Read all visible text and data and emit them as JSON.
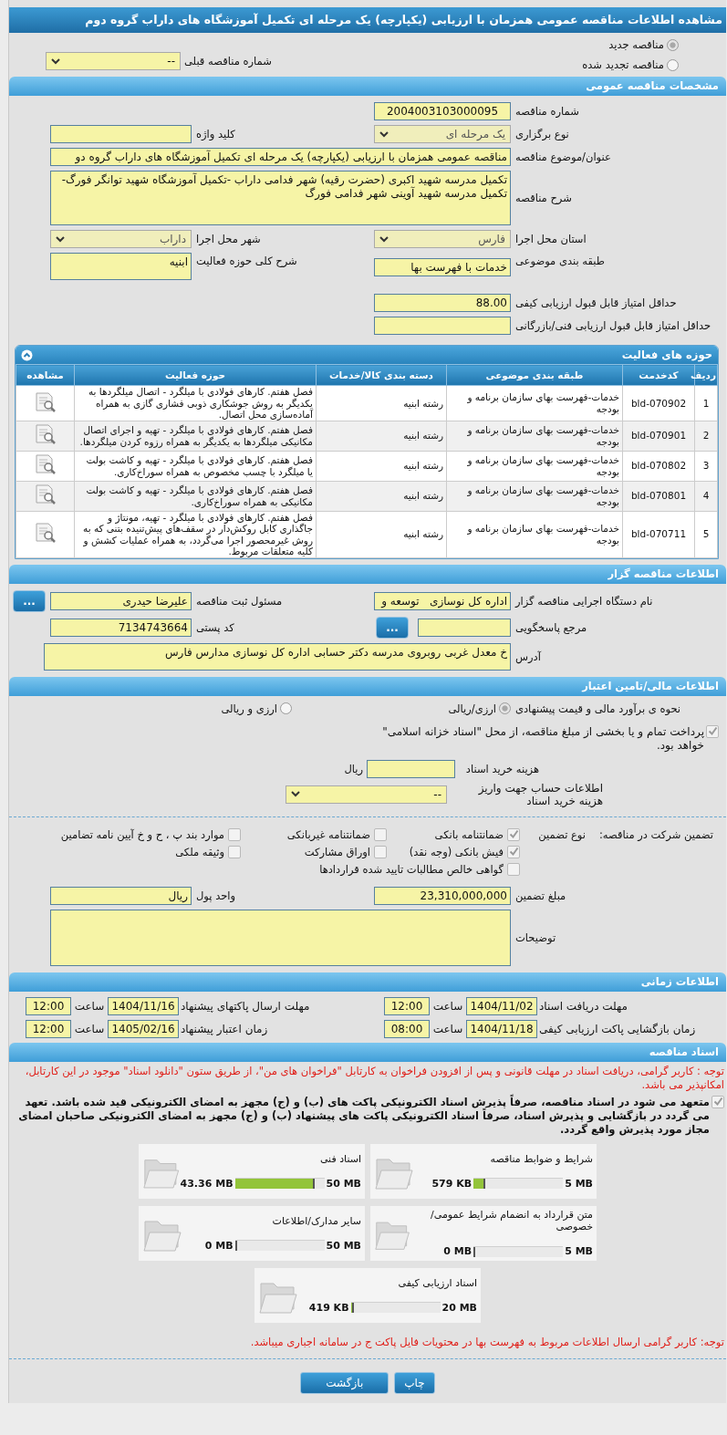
{
  "window": {
    "title": "مشاهده اطلاعات مناقصه عمومی همزمان با ارزیابی (یکپارچه) یک مرحله ای تکمیل آموزشگاه های داراب گروه دوم"
  },
  "tender_type": {
    "options": [
      {
        "label": "مناقصه جدید",
        "selected": true
      },
      {
        "label": "مناقصه تجدید شده",
        "selected": false
      }
    ],
    "previous": {
      "label": "شماره مناقصه قبلی",
      "value": "--",
      "disabled": false
    }
  },
  "general": {
    "heading": "مشخصات مناقصه عمومی",
    "number": {
      "label": "شماره مناقصه",
      "value": "2004003103000095"
    },
    "holding_type": {
      "label": "نوع برگزاری",
      "value": "یک مرحله ای",
      "disabled": true
    },
    "keyword": {
      "label": "کلید واژه"
    },
    "subject": {
      "label": "عنوان/موضوع مناقصه",
      "value": "مناقصه عمومی همزمان با ارزیابی (یکپارچه) یک مرحله ای تکمیل آموزشگاه های داراب گروه دو"
    },
    "description": {
      "label": "شرح مناقصه",
      "value": "تکمیل مدرسه شهید اکبری (حضرت رقیه) شهر فدامی داراب -تکمیل آموزشگاه شهید توانگر فورگ-تکمیل مدرسه شهید آوینی شهر فدامی فورگ"
    },
    "province": {
      "label": "استان محل اجرا",
      "value": "فارس",
      "disabled": true
    },
    "city": {
      "label": "شهر محل اجرا",
      "value": "داراب",
      "disabled": true
    },
    "category": {
      "label": "طبقه بندی موضوعی",
      "value": "خدمات با فهرست بها"
    },
    "activity_scope": {
      "label": "شرح کلی حوزه فعالیت",
      "value": "ابنیه"
    },
    "min_quality_score": {
      "label": "حداقل امتیاز قابل قبول ارزیابی کیفی",
      "value": "88.00"
    },
    "min_technical_score": {
      "label": "حداقل امتیاز قابل قبول ارزیابی فنی/بازرگانی"
    }
  },
  "activities": {
    "heading": "حوزه های فعالیت",
    "expanded": true,
    "columns": [
      "ردیف",
      "کدخدمت",
      "طبقه بندی موضوعی",
      "دسته بندی کالا/خدمات",
      "حوزه فعالیت",
      "مشاهده"
    ],
    "rows": [
      {
        "index": "1",
        "code": "bld-070902",
        "category": "خدمات-فهرست بهای سازمان برنامه و بودجه",
        "group": "رشته ابنیه",
        "scope": "فصل هفتم. کارهای فولادی با میلگرد - اتصال میلگردها به یکدیگر به روش جوشکاری ذوبی فشاری گازی به همراه آماده‌سازی محل اتصال."
      },
      {
        "index": "2",
        "code": "bld-070901",
        "category": "خدمات-فهرست بهای سازمان برنامه و بودجه",
        "group": "رشته ابنیه",
        "scope": "فصل هفتم. کارهای فولادی با میلگرد - تهیه و اجرای اتصال مکانیکی میلگردها به یکدیگر به همراه رزوه کردن میلگردها."
      },
      {
        "index": "3",
        "code": "bld-070802",
        "category": "خدمات-فهرست بهای سازمان برنامه و بودجه",
        "group": "رشته ابنیه",
        "scope": "فصل هفتم. کارهای فولادی با میلگرد - تهیه و کاشت بولت یا میلگرد با چسب مخصوص به همراه سوراخ‌کاری."
      },
      {
        "index": "4",
        "code": "bld-070801",
        "category": "خدمات-فهرست بهای سازمان برنامه و بودجه",
        "group": "رشته ابنیه",
        "scope": "فصل هفتم. کارهای فولادی با میلگرد - تهیه و کاشت بولت مکانیکی به همراه سوراخ‌کاری."
      },
      {
        "index": "5",
        "code": "bld-070711",
        "category": "خدمات-فهرست بهای سازمان برنامه و بودجه",
        "group": "رشته ابنیه",
        "scope": "فصل هفتم. کارهای فولادی با میلگرد - تهیه، مونتاژ و جاگذاری کابل روکش‌دار در سقف‌های پیش‌تنیده بتنی که به روش غیرمحصور اجرا می‌گردد، به همراه عملیات کشش و کلیه متعلقات مربوط."
      }
    ]
  },
  "issuer": {
    "heading": "اطلاعات مناقصه گزار",
    "agency": {
      "label": "نام دستگاه اجرایی مناقصه گزار",
      "value": "اداره کل نوسازی   توسعه و"
    },
    "registrar": {
      "label": "مسئول ثبت مناقصه",
      "value": "علیرضا حیدری",
      "button": "..."
    },
    "contact": {
      "label": "مرجع پاسخگویی",
      "button": "..."
    },
    "postal_code": {
      "label": "کد پستی",
      "value": "7134743664"
    },
    "address": {
      "label": "آدرس",
      "value": "خ معدل غربی روبروی مدرسه دکتر حسابی اداره کل نوسازی مدارس فارس"
    }
  },
  "finance": {
    "heading": "اطلاعات مالی/تامین اعتبار",
    "estimate_label": "نحوه ی برآورد مالی و قیمت پیشنهادی",
    "estimate_options": [
      {
        "label": "ارزی/ریالی",
        "selected": true
      },
      {
        "label": "ارزی و ریالی",
        "selected": false
      }
    ],
    "treasury": {
      "checked": true,
      "text": "پرداخت تمام و یا بخشی از مبلغ مناقصه، از محل \"اسناد خزانه اسلامی\" خواهد بود."
    },
    "document_fee": {
      "label": "هزینه خرید اسناد",
      "unit": "ریال"
    },
    "account": {
      "label": "اطلاعات حساب جهت واریز هزینه خرید اسناد",
      "value": "--",
      "disabled": false
    }
  },
  "guarantee": {
    "title": "تضمین شرکت در مناقصه:",
    "type_label": "نوع تضمین",
    "options": [
      {
        "label": "ضمانتنامه بانکی",
        "checked": true
      },
      {
        "label": "ضمانتنامه غیربانکی",
        "checked": false
      },
      {
        "label": "موارد بند پ ، ح و خ آیین نامه تضامین",
        "checked": false
      },
      {
        "label": "فیش بانکی (وجه نقد)",
        "checked": true
      },
      {
        "label": "اوراق مشارکت",
        "checked": false
      },
      {
        "label": "وثیقه ملکی",
        "checked": false
      },
      {
        "label": "گواهی خالص مطالبات تایید شده قراردادها",
        "checked": false
      }
    ],
    "amount": {
      "label": "مبلغ تضمین",
      "value": "23,310,000,000"
    },
    "currency": {
      "label": "واحد پول",
      "value": "ریال"
    },
    "notes": {
      "label": "توضیحات"
    }
  },
  "timing": {
    "heading": "اطلاعات زمانی",
    "rows": [
      [
        {
          "label": "مهلت دریافت اسناد",
          "date": "1404/11/02",
          "time_label": "ساعت",
          "time": "12:00"
        },
        {
          "label": "مهلت ارسال پاکتهای پیشنهاد",
          "date": "1404/11/16",
          "time_label": "ساعت",
          "time": "12:00"
        }
      ],
      [
        {
          "label": "زمان بازگشایی پاکت ارزیابی کیفی",
          "date": "1404/11/18",
          "time_label": "ساعت",
          "time": "08:00"
        },
        {
          "label": "زمان اعتبار پیشنهاد",
          "date": "1405/02/16",
          "time_label": "ساعت",
          "time": "12:00"
        }
      ]
    ]
  },
  "documents": {
    "heading": "اسناد مناقصه",
    "notice": "توجه : کاربر گرامی، دریافت اسناد در مهلت قانونی و پس از افزودن فراخوان به کارتابل \"فراخوان های من\"، از طریق ستون \"دانلود اسناد\" موجود در این کارتابل، امکانپذیر می باشد.",
    "commitment": {
      "checked": true,
      "text": "متعهد می شود در اسناد مناقصه، صرفاً پذیرش اسناد الکترونیکی پاکت های (ب) و (ج) مجهز به امضای الکترونیکی قید شده باشد. تعهد می گردد در بازگشایی و پذیرش اسناد، صرفاً اسناد الکترونیکی پاکت های پیشنهاد (ب) و (ج) مجهز به امضای الکترونیکی صاحبان امضای مجاز مورد پذیرش واقع گردد."
    },
    "files": [
      {
        "name": "شرایط و ضوابط مناقصه",
        "used": "579 KB",
        "max": "5 MB",
        "level": 0.11
      },
      {
        "name": "اسناد فنی",
        "used": "43.36 MB",
        "max": "50 MB",
        "level": 0.87
      },
      {
        "name": "متن قرارداد به انضمام شرایط عمومی/خصوصی",
        "used": "0 MB",
        "max": "5 MB",
        "level": 0
      },
      {
        "name": "سایر مدارک/اطلاعات",
        "used": "0 MB",
        "max": "50 MB",
        "level": 0
      },
      {
        "name": "اسناد ارزیابی کیفی",
        "used": "419 KB",
        "max": "20 MB",
        "level": 0.02
      }
    ],
    "note": "توجه: کاربر گرامی ارسال اطلاعات مربوط به فهرست بها در محتویات فایل پاکت ج در سامانه اجباری میباشد."
  },
  "buttons": [
    "چاپ",
    "بازگشت"
  ]
}
